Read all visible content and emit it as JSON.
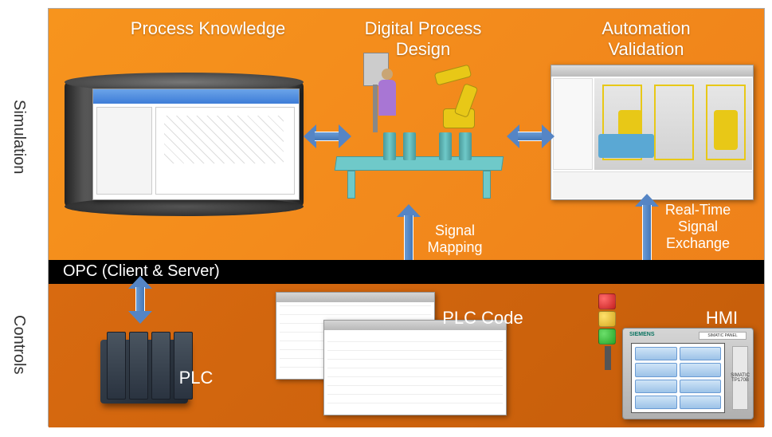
{
  "sideLabels": {
    "simulation": "Simulation",
    "controls": "Controls"
  },
  "titles": {
    "processKnowledge": "Process Knowledge",
    "digitalProcessDesign": "Digital Process Design",
    "automationValidation": "Automation Validation"
  },
  "labels": {
    "signalMapping": "Signal Mapping",
    "realTimeSignalExchange": "Real-Time Signal Exchange",
    "plc": "PLC",
    "plcCode": "PLC Code",
    "hmi": "HMI"
  },
  "opcBar": "OPC (Client & Server)",
  "hmi": {
    "brand": "SIEMENS",
    "model": "SIMATIC PANEL",
    "side": "SIMATIC TP170B"
  }
}
